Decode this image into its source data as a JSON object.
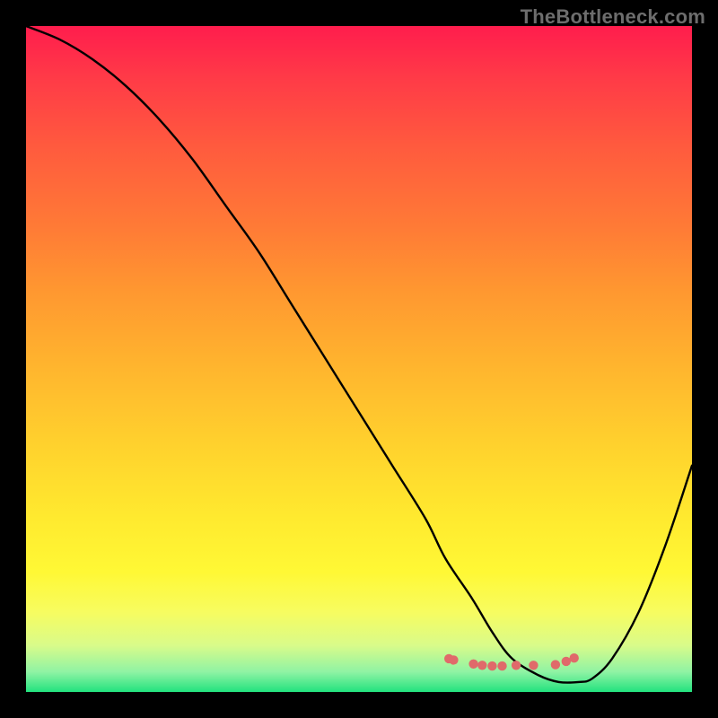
{
  "watermark": "TheBottleneck.com",
  "chart_data": {
    "type": "line",
    "title": "",
    "xlabel": "",
    "ylabel": "",
    "xlim": [
      0,
      100
    ],
    "ylim": [
      0,
      100
    ],
    "grid": false,
    "series": [
      {
        "name": "bottleneck-curve",
        "color": "#000000",
        "x": [
          0,
          5,
          10,
          15,
          20,
          25,
          30,
          35,
          40,
          45,
          50,
          55,
          60,
          63,
          67,
          70,
          73,
          77,
          80,
          83,
          85,
          88,
          92,
          96,
          100
        ],
        "y": [
          100,
          98,
          95,
          91,
          86,
          80,
          73,
          66,
          58,
          50,
          42,
          34,
          26,
          20,
          14,
          9,
          5,
          2.5,
          1.5,
          1.5,
          2,
          5,
          12,
          22,
          34
        ]
      },
      {
        "name": "marker-dots",
        "color": "#e06a6a",
        "x_pct": [
          63.5,
          64.2,
          67.2,
          68.5,
          70.0,
          71.5,
          73.6,
          76.2,
          79.5,
          81.1,
          82.3
        ],
        "y_pct": [
          95.0,
          95.2,
          95.8,
          96.0,
          96.1,
          96.1,
          96.0,
          96.0,
          95.9,
          95.4,
          94.9
        ]
      }
    ],
    "gradient_stops": [
      {
        "pos": 0.0,
        "color": "#ff1d4d"
      },
      {
        "pos": 0.08,
        "color": "#ff3b47"
      },
      {
        "pos": 0.18,
        "color": "#ff5a3e"
      },
      {
        "pos": 0.3,
        "color": "#ff7a36"
      },
      {
        "pos": 0.4,
        "color": "#ff9830"
      },
      {
        "pos": 0.52,
        "color": "#ffb72e"
      },
      {
        "pos": 0.64,
        "color": "#ffd42d"
      },
      {
        "pos": 0.74,
        "color": "#ffea2f"
      },
      {
        "pos": 0.82,
        "color": "#fff835"
      },
      {
        "pos": 0.88,
        "color": "#f7fc60"
      },
      {
        "pos": 0.93,
        "color": "#d9fb8a"
      },
      {
        "pos": 0.97,
        "color": "#8ff3a4"
      },
      {
        "pos": 1.0,
        "color": "#22e27e"
      }
    ]
  }
}
